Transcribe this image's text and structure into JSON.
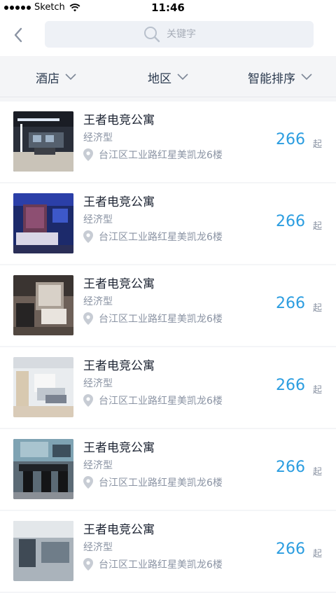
{
  "status_bar": {
    "carrier": "Sketch",
    "time": "11:46"
  },
  "nav": {
    "back_icon": "chevron-left-icon",
    "search_placeholder": "关键字"
  },
  "filters": [
    {
      "label": "酒店"
    },
    {
      "label": "地区"
    },
    {
      "label": "智能排序"
    }
  ],
  "hotels": [
    {
      "name": "王者电竞公寓",
      "type": "经济型",
      "address": "台江区工业路红星美凯龙6楼",
      "price": "266",
      "price_suffix": "起"
    },
    {
      "name": "王者电竞公寓",
      "type": "经济型",
      "address": "台江区工业路红星美凯龙6楼",
      "price": "266",
      "price_suffix": "起"
    },
    {
      "name": "王者电竞公寓",
      "type": "经济型",
      "address": "台江区工业路红星美凯龙6楼",
      "price": "266",
      "price_suffix": "起"
    },
    {
      "name": "王者电竞公寓",
      "type": "经济型",
      "address": "台江区工业路红星美凯龙6楼",
      "price": "266",
      "price_suffix": "起"
    },
    {
      "name": "王者电竞公寓",
      "type": "经济型",
      "address": "台江区工业路红星美凯龙6楼",
      "price": "266",
      "price_suffix": "起"
    },
    {
      "name": "王者电竞公寓",
      "type": "经济型",
      "address": "台江区工业路红星美凯龙6楼",
      "price": "266",
      "price_suffix": "起"
    }
  ],
  "colors": {
    "price": "#2b9de0",
    "muted": "#8a93a3",
    "title": "#1d2433",
    "search_bg": "#eef1f6"
  }
}
